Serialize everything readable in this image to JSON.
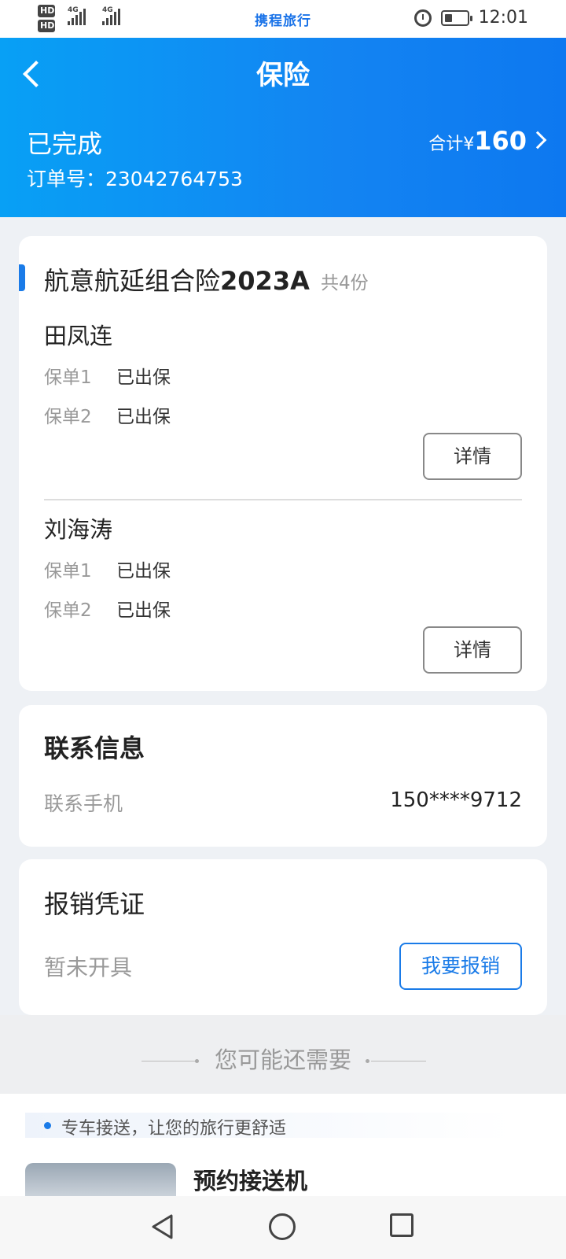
{
  "status_bar": {
    "hd1": "HD",
    "hd2": "HD",
    "net1": "4G",
    "net2": "4G",
    "carrier_logo": "携程旅行",
    "time": "12:01",
    "icons": [
      "alarm-icon",
      "battery-icon"
    ]
  },
  "header": {
    "title": "保险",
    "order_status": "已完成",
    "order_number": "订单号：23042764753",
    "total_label": "合计¥",
    "total_amount": "160"
  },
  "insurance": {
    "product_name": "航意航延组合险",
    "product_year": "2023A",
    "count": "共4份",
    "insured": [
      {
        "name": "田凤连",
        "policies": [
          {
            "label": "保单1",
            "status": "已出保"
          },
          {
            "label": "保单2",
            "status": "已出保"
          }
        ],
        "detail_label": "详情"
      },
      {
        "name": "刘海涛",
        "policies": [
          {
            "label": "保单1",
            "status": "已出保"
          },
          {
            "label": "保单2",
            "status": "已出保"
          }
        ],
        "detail_label": "详情"
      }
    ]
  },
  "contact": {
    "title": "联系信息",
    "phone_label": "联系手机",
    "phone_value": "150****9712"
  },
  "receipt": {
    "title": "报销凭证",
    "status": "暂未开具",
    "button_label": "我要报销"
  },
  "recommend": {
    "heading": "您可能还需要",
    "banner_text": "专车接送，让您的旅行更舒适",
    "item_title": "预约接送机"
  },
  "colors": {
    "primary": "#1a7be8",
    "header_gradient_start": "#08a0f5",
    "header_gradient_end": "#0d78f0"
  }
}
